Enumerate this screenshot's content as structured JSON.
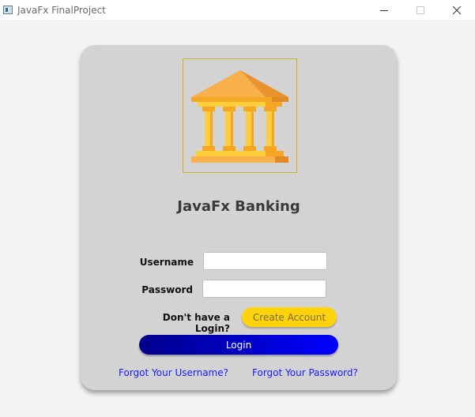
{
  "window": {
    "title": "JavaFx FinalProject",
    "controls": {
      "minimize_icon": "minimize-icon",
      "maximize_icon": "maximize-icon",
      "close_icon": "close-icon"
    }
  },
  "login_card": {
    "logo_icon": "bank-building-icon",
    "heading": "JavaFx Banking",
    "username_label": "Username",
    "username_value": "",
    "password_label": "Password",
    "password_value": "",
    "no_login_text": "Don't have a Login?",
    "create_account_label": "Create Account",
    "login_label": "Login",
    "forgot_username": "Forgot Your Username?",
    "forgot_password": "Forgot Your Password?"
  },
  "colors": {
    "card_background": "#d3d3d3",
    "create_button": "#ffd30b",
    "login_gradient_start": "#00008b",
    "login_gradient_end": "#0000ff",
    "link": "#1a1aff",
    "logo_gold": "#f5a623"
  }
}
